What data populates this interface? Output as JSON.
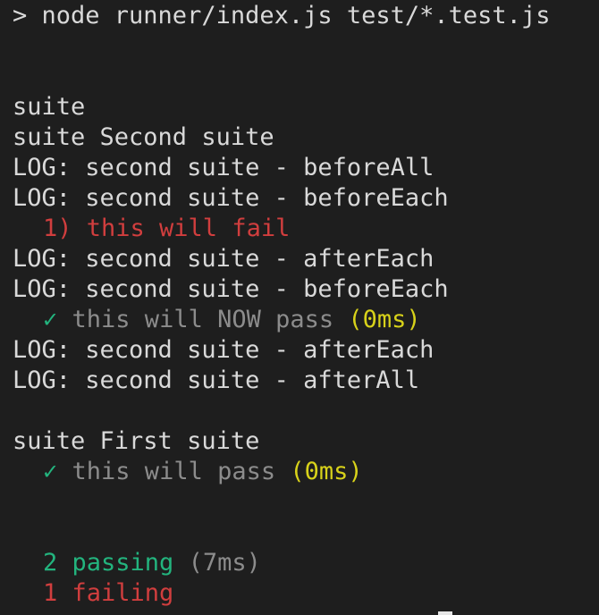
{
  "command": "> node runner/index.js test/*.test.js",
  "lines": {
    "suite_root": "suite",
    "suite_second": "suite Second suite",
    "log_before_all": "LOG: second suite - beforeAll",
    "log_before_each_1": "LOG: second suite - beforeEach",
    "fail_test": "1) this will fail",
    "log_after_each_1": "LOG: second suite - afterEach",
    "log_before_each_2": "LOG: second suite - beforeEach",
    "pass_check": "✓",
    "pass_test_1": "this will NOW pass",
    "pass_time_1": "(0ms)",
    "log_after_each_2": "LOG: second suite - afterEach",
    "log_after_all": "LOG: second suite - afterAll",
    "suite_first": "suite First suite",
    "pass_test_2": "this will pass",
    "pass_time_2": "(0ms)"
  },
  "summary": {
    "passing_count": "2 passing",
    "passing_time": "(7ms)",
    "failing_count": "1 failing"
  },
  "colors": {
    "background": "#1e1e1e",
    "text": "#d9d9d9",
    "fail": "#d13e3e",
    "pass": "#23b47e",
    "muted": "#8c8c8c",
    "time": "#d8d21a"
  }
}
